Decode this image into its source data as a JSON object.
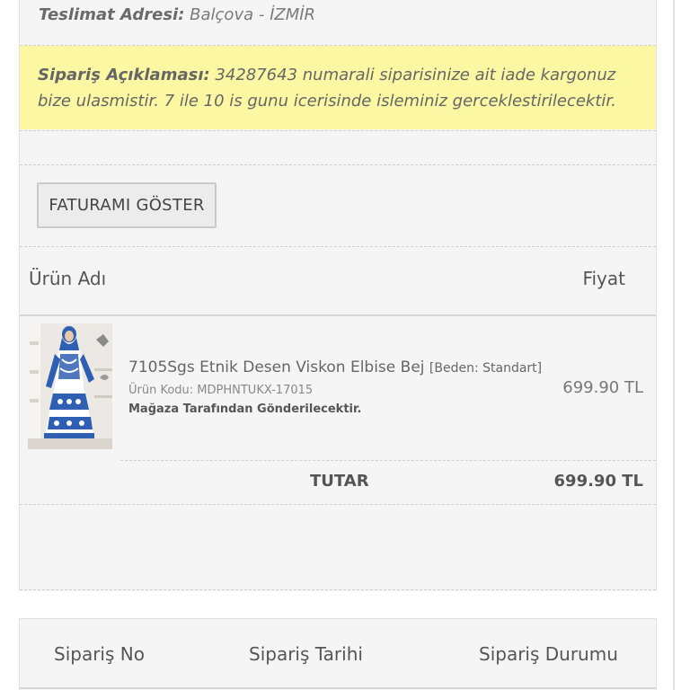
{
  "delivery": {
    "label": "Teslimat Adresi:",
    "value": "Balçova - İZMİR"
  },
  "note": {
    "label": "Sipariş Açıklaması:",
    "text": "34287643 numarali siparisinize ait iade kargonuz bize ulasmistir. 7 ile 10 is gunu icerisinde isleminiz gerceklestirilecektir."
  },
  "invoice_button": "FATURAMI GÖSTER",
  "table": {
    "col_product": "Ürün Adı",
    "col_price": "Fiyat"
  },
  "item": {
    "name": "7105Sgs Etnik Desen Viskon Elbise Bej",
    "size": "[Beden: Standart]",
    "code": "Ürün Kodu: MDPHNTUKX-17015",
    "shipping": "Mağaza Tarafından Gönderilecektir.",
    "price": "699.90 TL"
  },
  "total": {
    "label": "TUTAR",
    "value": "699.90 TL"
  },
  "orders_header": {
    "order_no": "Sipariş No",
    "order_date": "Sipariş Tarihi",
    "order_status": "Sipariş Durumu"
  },
  "colors": {
    "note_bg": "#fbf7a2",
    "card_bg": "#f5f5f5",
    "dress_blue": "#2f5fb3"
  }
}
